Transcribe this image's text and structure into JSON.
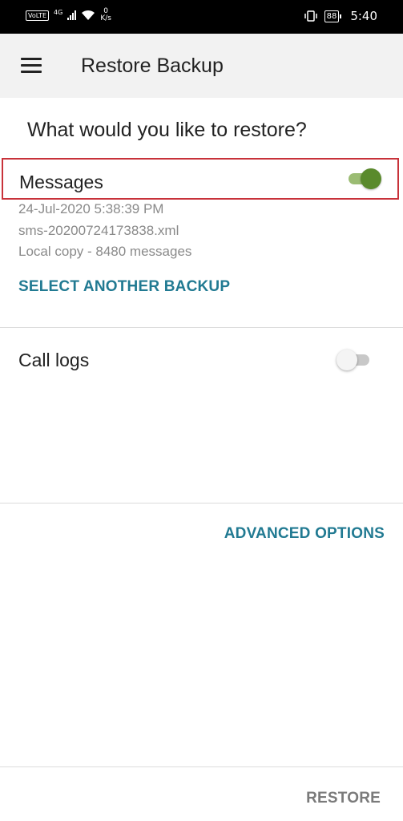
{
  "status_bar": {
    "volte": "VoLTE",
    "network": "4G",
    "speed_value": "0",
    "speed_unit": "K/s",
    "battery": "88",
    "time": "5:40"
  },
  "app_bar": {
    "title": "Restore Backup",
    "menu_icon": "hamburger-menu-icon"
  },
  "content": {
    "question": "What would you like to restore?",
    "messages": {
      "label": "Messages",
      "enabled": true,
      "date": "24-Jul-2020 5:38:39 PM",
      "filename": "sms-20200724173838.xml",
      "info": "Local copy - 8480 messages",
      "select_backup_label": "SELECT ANOTHER BACKUP"
    },
    "call_logs": {
      "label": "Call logs",
      "enabled": false
    },
    "advanced_options_label": "ADVANCED OPTIONS",
    "restore_label": "RESTORE"
  },
  "colors": {
    "accent": "#217a92",
    "toggle_on": "#5a8a2c",
    "highlight": "#c8323a",
    "disabled_text": "#7a7a7a"
  }
}
